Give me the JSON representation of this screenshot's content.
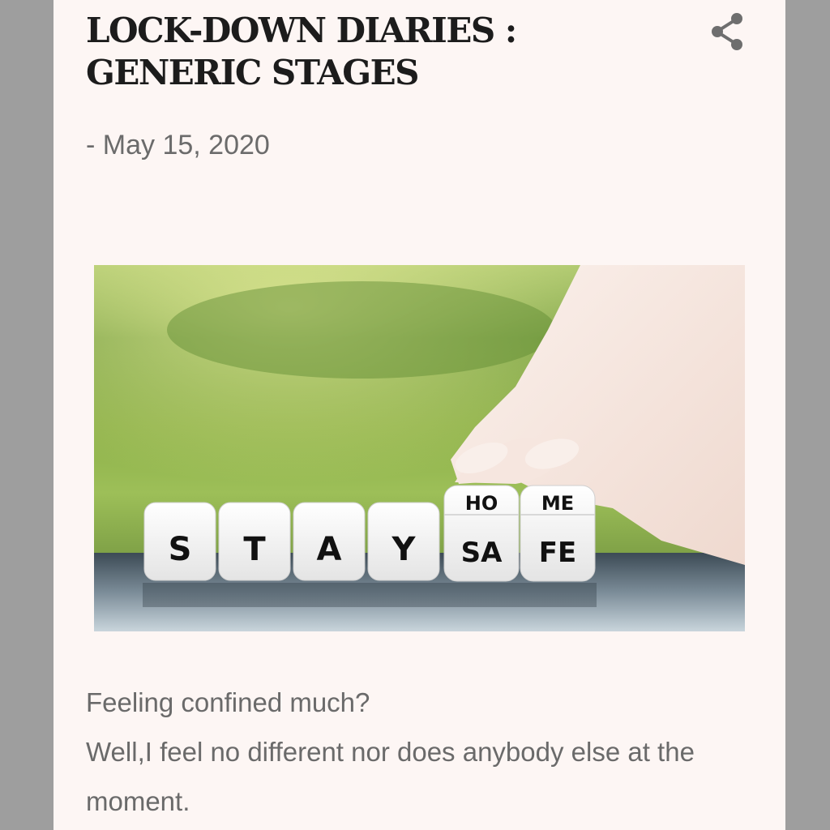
{
  "post": {
    "title": "LOCK-DOWN DIARIES : GENERIC STAGES",
    "date": "- May 15, 2020",
    "share_icon": "share-icon",
    "image": {
      "dice_bottom": [
        "S",
        "T",
        "A",
        "Y",
        "SA",
        "FE"
      ],
      "dice_top": [
        "HO",
        "ME"
      ]
    },
    "body": [
      "Feeling confined much?",
      "Well,I feel no different nor does anybody else at the moment."
    ]
  },
  "colors": {
    "page_background": "#fdf6f4",
    "outer_background": "#9e9e9e",
    "title": "#1c1c1c",
    "text": "#6a6a6a"
  }
}
